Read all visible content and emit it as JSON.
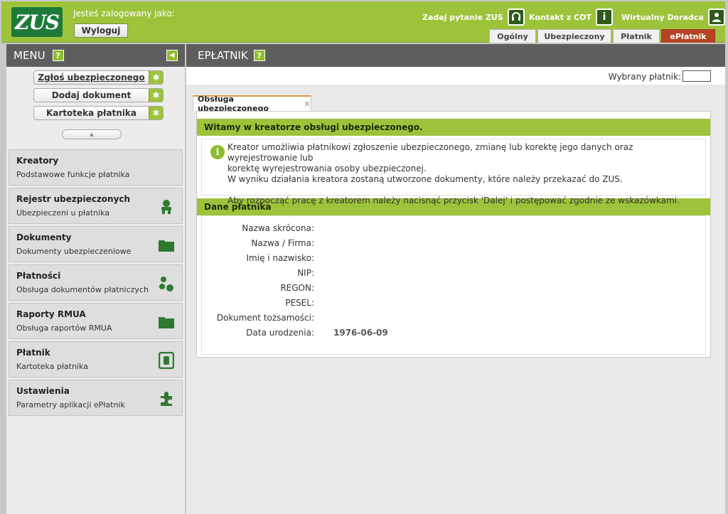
{
  "header": {
    "logo_text": "ZUS",
    "logged_in_label": "Jesteś zalogowany jako:",
    "logout_label": "Wyloguj",
    "ask_label": "Zadaj pytanie ZUS",
    "contact_label": "Kontakt z COT",
    "advisor_label": "Wirtualny Doradca",
    "tabs": [
      {
        "label": "Ogólny"
      },
      {
        "label": "Ubezpieczony"
      },
      {
        "label": "Płatnik"
      },
      {
        "label": "ePłatnik"
      }
    ]
  },
  "sidebar": {
    "title": "MENU",
    "help": "?",
    "quick": [
      {
        "label": "Zgłoś ubezpieczonego"
      },
      {
        "label": "Dodaj dokument"
      },
      {
        "label": "Kartoteka płatnika"
      }
    ],
    "scroll_arrow": "▲",
    "items": [
      {
        "title": "Kreatory",
        "subtitle": "Podstawowe funkcje płatnika",
        "icon": ""
      },
      {
        "title": "Rejestr ubezpieczonych",
        "subtitle": "Ubezpieczeni u płatnika",
        "icon": "people-icon"
      },
      {
        "title": "Dokumenty",
        "subtitle": "Dokumenty ubezpieczeniowe",
        "icon": "folder-icon"
      },
      {
        "title": "Płatności",
        "subtitle": "Obsługa dokumentów płatniczych",
        "icon": "coins-icon"
      },
      {
        "title": "Raporty RMUA",
        "subtitle": "Obsługa raportów RMUA",
        "icon": "folder-icon"
      },
      {
        "title": "Płatnik",
        "subtitle": "Kartoteka płatnika",
        "icon": "binder-icon"
      },
      {
        "title": "Ustawienia",
        "subtitle": "Parametry aplikacji ePłatnik",
        "icon": "puzzle-icon"
      }
    ]
  },
  "main": {
    "title": "EPŁATNIK",
    "help": "?",
    "payer_label": "Wybrany płatnik:",
    "tab_label": "Obsługa ubezpieczonego",
    "tab_close": "×",
    "welcome_heading": "Witamy w kreatorze obsługi ubezpieczonego.",
    "info_line1": "Kreator umożliwia płatnikowi zgłoszenie ubezpieczonego, zmianę lub korektę jego danych oraz wyrejestrowanie lub",
    "info_line2": "korektę wyrejestrowania osoby ubezpieczonej.",
    "info_line3": "W wyniku działania kreatora zostaną utworzone dokumenty, które należy przekazać do ZUS.",
    "info_line4": "Aby rozpocząć pracę z kreatorem należy nacisnąć przycisk 'Dalej' i postępować zgodnie ze wskazówkami.",
    "payer_section": "Dane płatnika",
    "fields": [
      {
        "label": "Nazwa skrócona:",
        "value": ""
      },
      {
        "label": "Nazwa / Firma:",
        "value": ""
      },
      {
        "label": "Imię i nazwisko:",
        "value": ""
      },
      {
        "label": "NIP:",
        "value": ""
      },
      {
        "label": "REGON:",
        "value": ""
      },
      {
        "label": "PESEL:",
        "value": ""
      },
      {
        "label": "Dokument tożsamości:",
        "value": ""
      },
      {
        "label": "Data urodzenia:",
        "value": "1976-06-09"
      }
    ]
  },
  "colors": {
    "brand_green": "#9dc33b",
    "dark_header": "#5e5e5e",
    "active_tab": "#b54323"
  }
}
